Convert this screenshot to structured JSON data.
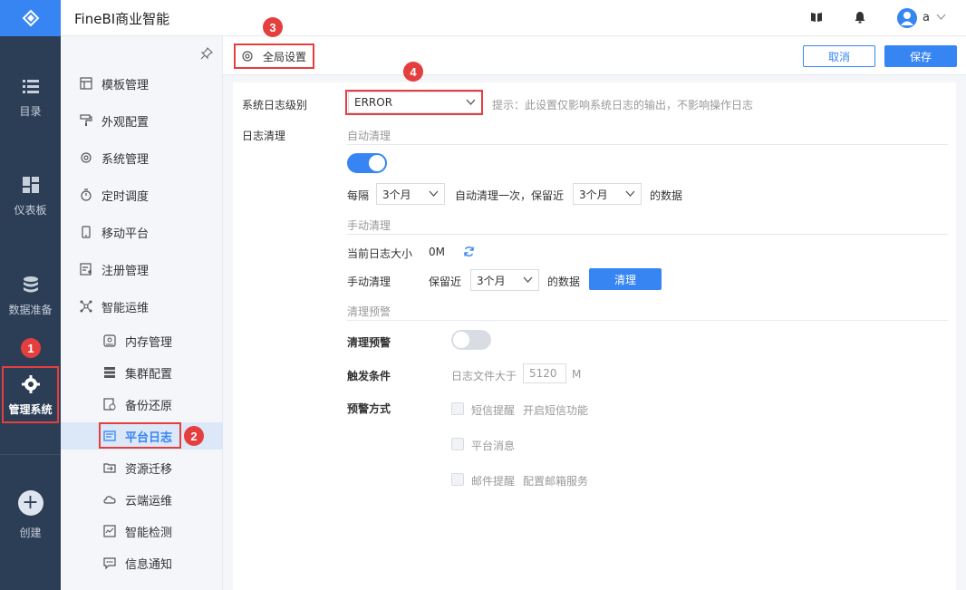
{
  "app": {
    "title": "FineBI商业智能",
    "user": "a"
  },
  "colors": {
    "brand": "#3685f2",
    "rail": "#2c3e55",
    "annotation": "#e53e3e"
  },
  "rail": {
    "items": [
      {
        "label": "目录",
        "icon": "list-icon"
      },
      {
        "label": "仪表板",
        "icon": "dashboard-icon"
      },
      {
        "label": "数据准备",
        "icon": "database-icon"
      },
      {
        "label": "管理系统",
        "icon": "gear-icon",
        "active": true
      },
      {
        "label": "创建",
        "icon": "plus-icon"
      }
    ]
  },
  "sidebar": {
    "items": [
      {
        "label": "模板管理",
        "icon": "template-icon"
      },
      {
        "label": "外观配置",
        "icon": "paint-roller-icon"
      },
      {
        "label": "系统管理",
        "icon": "gear-icon"
      },
      {
        "label": "定时调度",
        "icon": "stopwatch-icon"
      },
      {
        "label": "移动平台",
        "icon": "mobile-icon"
      },
      {
        "label": "注册管理",
        "icon": "register-icon"
      },
      {
        "label": "智能运维",
        "icon": "network-icon"
      }
    ],
    "subitems": [
      {
        "label": "内存管理",
        "icon": "memory-icon"
      },
      {
        "label": "集群配置",
        "icon": "cluster-icon"
      },
      {
        "label": "备份还原",
        "icon": "backup-icon"
      },
      {
        "label": "平台日志",
        "icon": "log-icon",
        "active": true
      },
      {
        "label": "资源迁移",
        "icon": "migrate-icon"
      },
      {
        "label": "云端运维",
        "icon": "cloud-icon"
      },
      {
        "label": "智能检测",
        "icon": "monitor-icon"
      },
      {
        "label": "信息通知",
        "icon": "message-icon"
      }
    ]
  },
  "toolbar": {
    "tab_label": "全局设置",
    "cancel_label": "取消",
    "save_label": "保存"
  },
  "form": {
    "log_level_label": "系统日志级别",
    "log_level_value": "ERROR",
    "log_level_hint": "提示：此设置仅影响系统日志的输出，不影响操作日志",
    "log_cleanup_label": "日志清理",
    "auto_section": "自动清理",
    "auto_enabled": true,
    "every_label": "每隔",
    "every_value": "3个月",
    "auto_middle": "自动清理一次，保留近",
    "keep_value": "3个月",
    "data_suffix": "的数据",
    "manual_section": "手动清理",
    "current_size_label": "当前日志大小",
    "current_size_value": "0M",
    "manual_label": "手动清理",
    "manual_keep_prefix": "保留近",
    "manual_keep_value": "3个月",
    "manual_data_suffix": "的数据",
    "clear_button": "清理",
    "warning_section": "清理预警",
    "warning_label": "清理预警",
    "warning_enabled": false,
    "trigger_label": "触发条件",
    "trigger_prefix": "日志文件大于",
    "trigger_value": "5120",
    "trigger_unit": "M",
    "method_label": "预警方式",
    "methods": [
      {
        "label": "短信提醒",
        "link": "开启短信功能"
      },
      {
        "label": "平台消息",
        "link": ""
      },
      {
        "label": "邮件提醒",
        "link": "配置邮箱服务"
      }
    ]
  },
  "annotations": [
    "1",
    "2",
    "3",
    "4"
  ]
}
